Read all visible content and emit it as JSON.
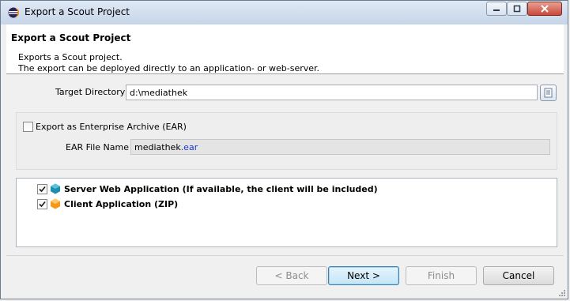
{
  "window": {
    "title": "Export a Scout Project"
  },
  "header": {
    "title": "Export a Scout Project",
    "description_line1": "Exports a Scout project.",
    "description_line2": "The export can be deployed directly to an application- or web-server."
  },
  "target": {
    "label": "Target Directory",
    "value": "d:\\mediathek"
  },
  "ear": {
    "checkbox_label": "Export as Enterprise Archive (EAR)",
    "checked": false,
    "file_label": "EAR File Name",
    "file_name": "mediathek",
    "file_ext": ".ear"
  },
  "apps": [
    {
      "label": "Server Web Application (If available, the client will be included)",
      "checked": true,
      "icon": "server-app-icon",
      "color": "#1f8fae"
    },
    {
      "label": "Client Application (ZIP)",
      "checked": true,
      "icon": "client-app-icon",
      "color": "#f39a1c"
    }
  ],
  "buttons": {
    "back": "< Back",
    "next": "Next >",
    "finish": "Finish",
    "cancel": "Cancel"
  }
}
